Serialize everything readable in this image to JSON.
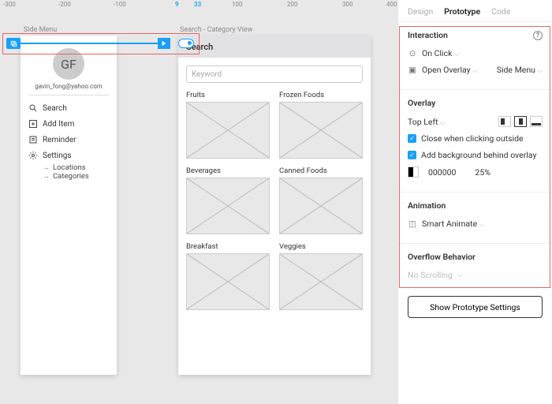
{
  "ruler": {
    "ticks": [
      "-300",
      "-200",
      "-100",
      "9",
      "33",
      "100",
      "200",
      "300",
      "400"
    ]
  },
  "frames": {
    "side_label": "Side Menu",
    "search_label": "Search - Category View"
  },
  "side_menu": {
    "avatar": "GF",
    "email": "gavin_fong@yahoo.com",
    "items": [
      {
        "label": "Search",
        "icon": "search-icon"
      },
      {
        "label": "Add Item",
        "icon": "plus-box-icon"
      },
      {
        "label": "Reminder",
        "icon": "note-icon"
      },
      {
        "label": "Settings",
        "icon": "gear-icon"
      }
    ],
    "sub_items": [
      "Locations",
      "Categories"
    ]
  },
  "search": {
    "title": "Search",
    "keyword_placeholder": "Keyword",
    "categories": [
      "Fruits",
      "Frozen Foods",
      "Beverages",
      "Canned Foods",
      "Breakfast",
      "Veggies"
    ]
  },
  "panel": {
    "tabs": [
      "Design",
      "Prototype",
      "Code"
    ],
    "interaction": {
      "title": "Interaction",
      "trigger": "On Click",
      "action": "Open Overlay",
      "target": "Side Menu"
    },
    "overlay": {
      "title": "Overlay",
      "position": "Top Left",
      "close_outside": "Close when clicking outside",
      "add_bg": "Add background behind overlay",
      "bg_color": "000000",
      "bg_opacity": "25%"
    },
    "animation": {
      "title": "Animation",
      "type": "Smart Animate"
    },
    "overflow": {
      "title": "Overflow Behavior",
      "value": "No Scrolling"
    },
    "settings_btn": "Show Prototype Settings"
  }
}
